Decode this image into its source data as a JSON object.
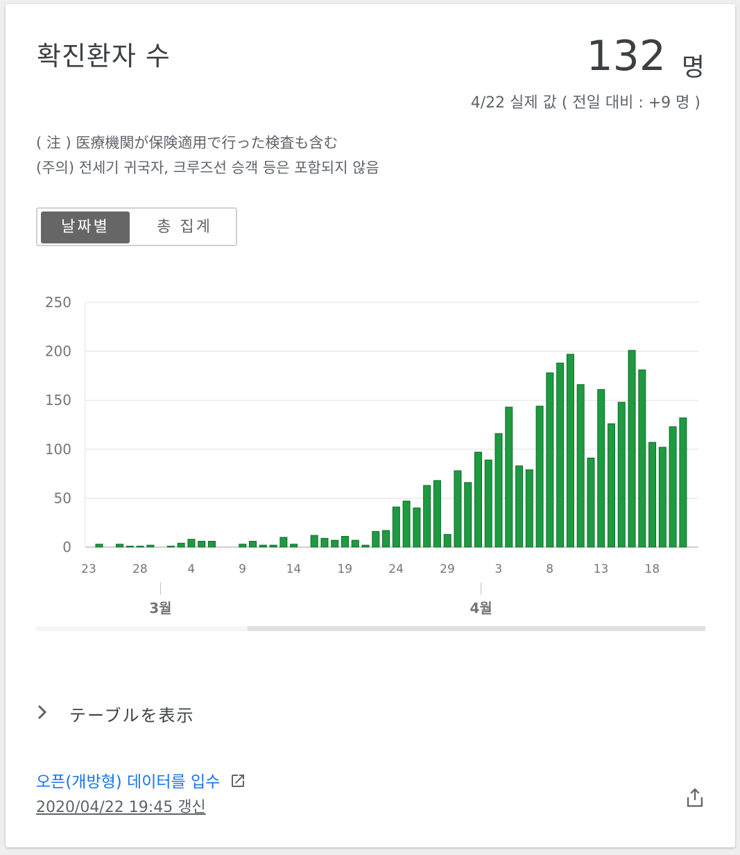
{
  "title": "확진환자 수",
  "value": "132",
  "unit": "명",
  "subline": "4/22 실제 값 ( 전일 대비 : +9 명 )",
  "notes": [
    "( 注 ) 医療機関が保険適用で行った検査も含む",
    "(주의) 전세기 귀국자, 크루즈선 승객 등은 포함되지 않음"
  ],
  "toggle": {
    "daily": "날짜별",
    "total": "총 집계"
  },
  "table_toggle": "テーブルを表示",
  "open_data": "오픈(개방형) 데이터를 입수",
  "updated": "2020/04/22 19:45 갱신",
  "colors": {
    "bar": "#1e9a41",
    "bar_edge": "#0d6b2a",
    "grid": "#e0e0e0"
  },
  "icons": {
    "chevron": "chevron-right-icon",
    "external": "external-link-icon",
    "share": "share-icon"
  },
  "chart_data": {
    "type": "bar",
    "title": "",
    "xlabel": "",
    "ylabel": "",
    "ylim": [
      0,
      250
    ],
    "yticks": [
      0,
      50,
      100,
      150,
      200,
      250
    ],
    "grid": true,
    "legend": "none",
    "x_tick_labels": [
      {
        "index": 0,
        "label": "23"
      },
      {
        "index": 5,
        "label": "28"
      },
      {
        "index": 10,
        "label": "4"
      },
      {
        "index": 15,
        "label": "9"
      },
      {
        "index": 20,
        "label": "14"
      },
      {
        "index": 25,
        "label": "19"
      },
      {
        "index": 30,
        "label": "24"
      },
      {
        "index": 35,
        "label": "29"
      },
      {
        "index": 40,
        "label": "3"
      },
      {
        "index": 45,
        "label": "8"
      },
      {
        "index": 50,
        "label": "13"
      },
      {
        "index": 55,
        "label": "18"
      }
    ],
    "month_labels": [
      {
        "index": 7,
        "label": "3월"
      },
      {
        "index": 38.3,
        "label": "4월"
      }
    ],
    "categories": [
      "2/23",
      "2/24",
      "2/25",
      "2/26",
      "2/27",
      "2/28",
      "2/29",
      "3/1",
      "3/2",
      "3/3",
      "3/4",
      "3/5",
      "3/6",
      "3/7",
      "3/8",
      "3/9",
      "3/10",
      "3/11",
      "3/12",
      "3/13",
      "3/14",
      "3/15",
      "3/16",
      "3/17",
      "3/18",
      "3/19",
      "3/20",
      "3/21",
      "3/22",
      "3/23",
      "3/24",
      "3/25",
      "3/26",
      "3/27",
      "3/28",
      "3/29",
      "3/30",
      "3/31",
      "4/1",
      "4/2",
      "4/3",
      "4/4",
      "4/5",
      "4/6",
      "4/7",
      "4/8",
      "4/9",
      "4/10",
      "4/11",
      "4/12",
      "4/13",
      "4/14",
      "4/15",
      "4/16",
      "4/17",
      "4/18",
      "4/19",
      "4/20",
      "4/21",
      "4/22"
    ],
    "values": [
      3,
      0,
      3,
      1,
      1,
      2,
      0,
      1,
      4,
      8,
      6,
      6,
      0,
      0,
      3,
      6,
      2,
      2,
      10,
      3,
      0,
      12,
      9,
      7,
      11,
      7,
      2,
      16,
      17,
      41,
      47,
      40,
      63,
      68,
      13,
      78,
      66,
      97,
      89,
      116,
      143,
      83,
      79,
      144,
      178,
      188,
      197,
      166,
      91,
      161,
      126,
      148,
      201,
      181,
      107,
      102,
      123,
      132
    ]
  }
}
